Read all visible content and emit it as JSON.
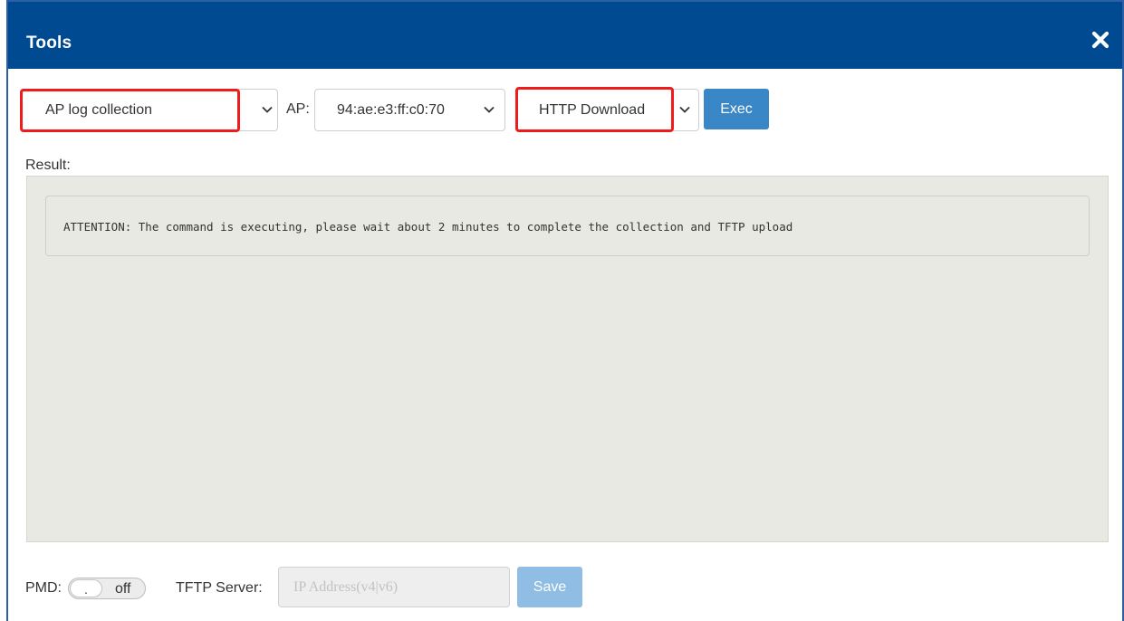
{
  "dialog": {
    "title": "Tools",
    "close_icon": "close-x-icon"
  },
  "toolbar": {
    "tool_select": {
      "value": "AP log collection"
    },
    "ap_label": "AP:",
    "ap_select": {
      "value": "94:ae:e3:ff:c0:70"
    },
    "method_select": {
      "value": "HTTP Download"
    },
    "exec_label": "Exec",
    "highlight_color": "#ee1c1c"
  },
  "result": {
    "label": "Result:",
    "message": "ATTENTION: The command is executing, please wait about 2 minutes to complete the collection and TFTP upload"
  },
  "footer": {
    "pmd_label": "PMD:",
    "pmd_toggle": {
      "knob": ".",
      "state": "off"
    },
    "tftp_label": "TFTP Server:",
    "tftp_input": {
      "value": "",
      "placeholder": "IP Address(v4|v6)"
    },
    "save_label": "Save"
  },
  "colors": {
    "header": "#004a91",
    "primary_button": "#3a87c8",
    "disabled_button": "#8fbde3"
  }
}
